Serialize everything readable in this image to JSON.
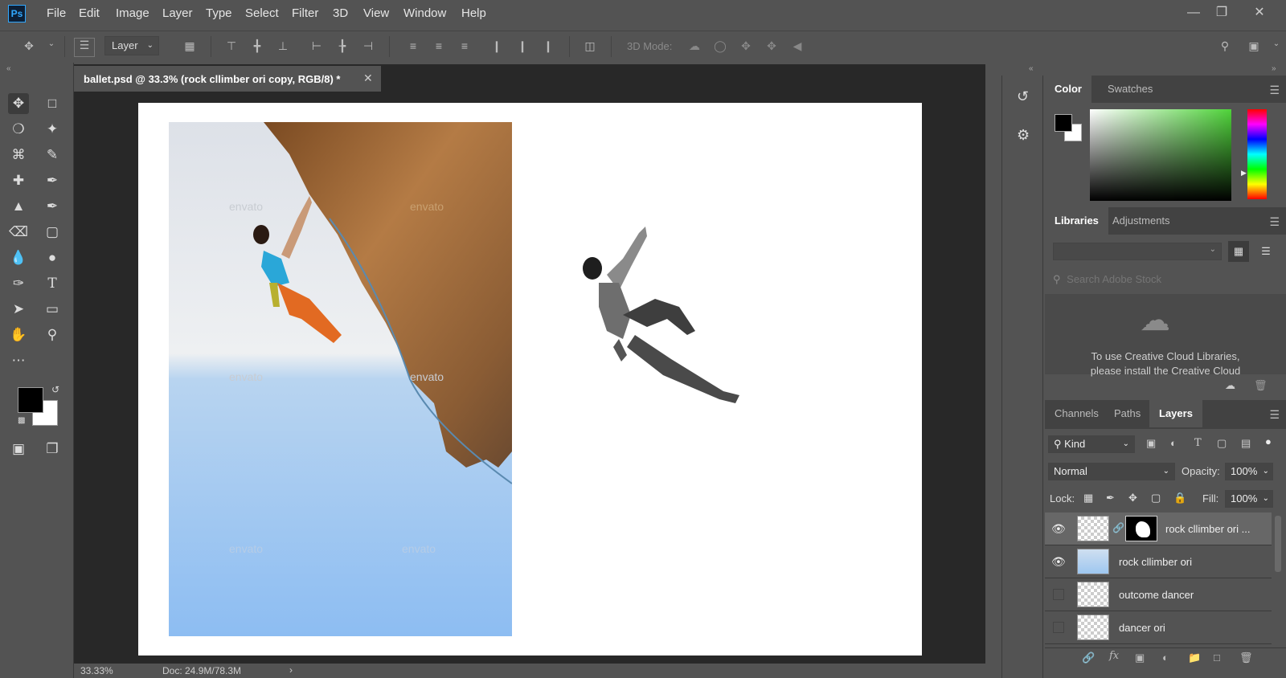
{
  "app": {
    "logo": "Ps"
  },
  "menu": [
    "File",
    "Edit",
    "Image",
    "Layer",
    "Type",
    "Select",
    "Filter",
    "3D",
    "View",
    "Window",
    "Help"
  ],
  "options": {
    "auto_select": "Layer",
    "mode_3d": "3D Mode:"
  },
  "document": {
    "tab_title": "ballet.psd @ 33.3% (rock cllimber ori copy, RGB/8) *",
    "zoom": "33.33%",
    "doc_info": "Doc: 24.9M/78.3M"
  },
  "panels": {
    "color_tabs": [
      "Color",
      "Swatches"
    ],
    "libraries_tabs": [
      "Libraries",
      "Adjustments"
    ],
    "library_search_placeholder": "Search Adobe Stock",
    "library_msg_1": "To use Creative Cloud Libraries,",
    "library_msg_2": "please install the Creative Cloud",
    "layers_tabs": [
      "Channels",
      "Paths",
      "Layers"
    ],
    "kind_filter": "Kind",
    "blend_mode": "Normal",
    "opacity_label": "Opacity:",
    "opacity_value": "100%",
    "lock_label": "Lock:",
    "fill_label": "Fill:",
    "fill_value": "100%"
  },
  "layers": [
    {
      "name": "rock cllimber ori ...",
      "visible": true,
      "selected": true
    },
    {
      "name": "rock cllimber ori",
      "visible": true,
      "selected": false
    },
    {
      "name": "outcome dancer",
      "visible": false,
      "selected": false
    },
    {
      "name": "dancer ori",
      "visible": false,
      "selected": false
    }
  ],
  "watermark": "envato",
  "colors": {
    "fg": "#000000",
    "bg": "#ffffff",
    "accent": "#31a8ff"
  }
}
